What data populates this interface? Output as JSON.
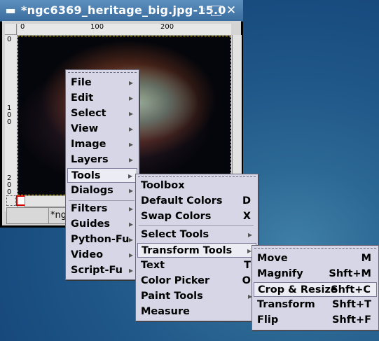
{
  "window": {
    "title": "*ngc6369_heritage_big.jpg-15.0",
    "status_text": "*ng",
    "ruler_h_ticks": [
      "0",
      "100",
      "200"
    ],
    "ruler_v_ticks": [
      "0",
      "100",
      "200"
    ]
  },
  "menu_main": {
    "groups": [
      [
        "File",
        "Edit",
        "Select",
        "View",
        "Image",
        "Layers",
        "Tools",
        "Dialogs"
      ],
      [
        "Filters",
        "Guides",
        "Python-Fu",
        "Video",
        "Script-Fu"
      ]
    ],
    "highlighted": "Tools"
  },
  "menu_tools": {
    "groups": [
      [
        {
          "label": "Toolbox",
          "shortcut": ""
        },
        {
          "label": "Default Colors",
          "shortcut": "D"
        },
        {
          "label": "Swap Colors",
          "shortcut": "X"
        }
      ],
      [
        {
          "label": "Select Tools",
          "shortcut": ""
        },
        {
          "label": "Transform Tools",
          "shortcut": ""
        },
        {
          "label": "Text",
          "shortcut": "T"
        },
        {
          "label": "Color Picker",
          "shortcut": "O"
        },
        {
          "label": "Paint Tools",
          "shortcut": ""
        },
        {
          "label": "Measure",
          "shortcut": ""
        }
      ]
    ],
    "highlighted": "Transform Tools"
  },
  "menu_transform": {
    "items": [
      {
        "label": "Move",
        "shortcut": "M"
      },
      {
        "label": "Magnify",
        "shortcut": "Shft+M"
      },
      {
        "label": "Crop & Resize",
        "shortcut": "Shft+C"
      },
      {
        "label": "Transform",
        "shortcut": "Shft+T"
      },
      {
        "label": "Flip",
        "shortcut": "Shft+F"
      }
    ],
    "highlighted": "Crop & Resize"
  },
  "icons": {
    "window_menu": "window-menu-icon",
    "shade": "shade-icon",
    "maximize": "maximize-icon",
    "close": "close-icon",
    "submenu": "submenu-arrow-icon",
    "quickmask": "quickmask-icon",
    "navigate": "navigate-icon"
  }
}
